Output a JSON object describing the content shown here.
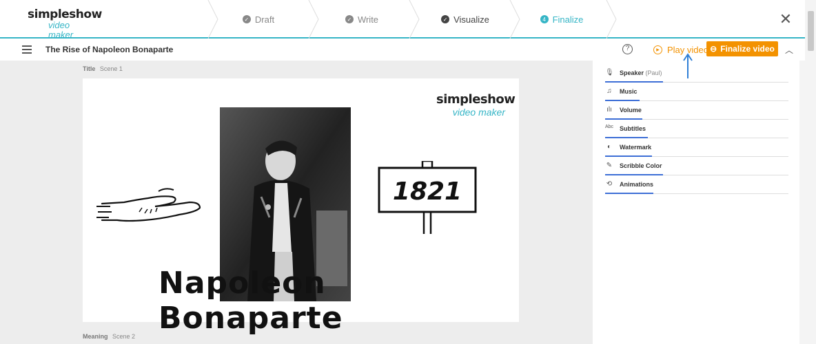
{
  "app": {
    "logo_line1": "simpleshow",
    "logo_line2": "video maker"
  },
  "steps": [
    {
      "label": "Draft",
      "state": "done"
    },
    {
      "label": "Write",
      "state": "done"
    },
    {
      "label": "Visualize",
      "state": "done"
    },
    {
      "label": "Finalize",
      "state": "active",
      "number": "4"
    }
  ],
  "toolbar": {
    "project_title": "The Rise of Napoleon Bonaparte",
    "help_icon": "?",
    "play_label": "Play video",
    "finalize_label": "Finalize video"
  },
  "scenes": [
    {
      "type": "Title",
      "name": "Scene 1"
    },
    {
      "type": "Meaning",
      "name": "Scene 2"
    }
  ],
  "canvas": {
    "logo_line1": "simpleshow",
    "logo_line2": "video maker",
    "caption": "Napoleon Bonaparte",
    "sign_text": "1821"
  },
  "settings": [
    {
      "label": "Speaker",
      "extra": "(Paul)",
      "icon": "microphone-icon"
    },
    {
      "label": "Music",
      "extra": "",
      "icon": "music-note-icon"
    },
    {
      "label": "Volume",
      "extra": "",
      "icon": "volume-bars-icon"
    },
    {
      "label": "Subtitles",
      "extra": "",
      "icon": "subtitles-icon"
    },
    {
      "label": "Watermark",
      "extra": "",
      "icon": "watermark-icon"
    },
    {
      "label": "Scribble Color",
      "extra": "",
      "icon": "pen-icon"
    },
    {
      "label": "Animations",
      "extra": "",
      "icon": "animation-icon"
    }
  ],
  "colors": {
    "accent": "#35b5c6",
    "orange": "#f39200",
    "setting_underline": "#3c6ed6"
  }
}
